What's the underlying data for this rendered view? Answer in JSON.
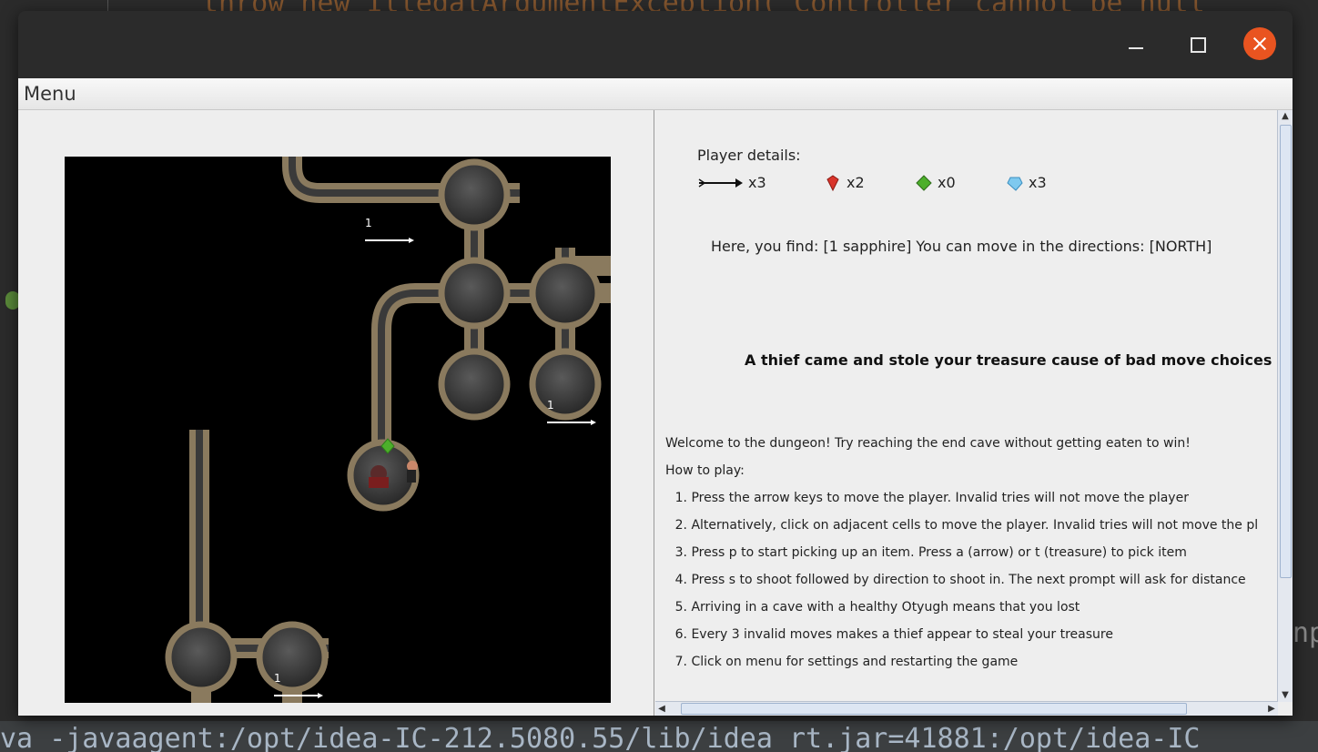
{
  "background": {
    "code_top": "throw new IllegalArgumentException(\"Controller cannot be null",
    "code_bottom": "va -javaagent:/opt/idea-IC-212.5080.55/lib/idea_rt.jar=41881:/opt/idea-IC",
    "right_fragment": "np"
  },
  "window": {
    "controls": {
      "minimize": "minimize-icon",
      "maximize": "maximize-icon",
      "close": "close-icon"
    }
  },
  "menubar": {
    "menu_label": "Menu"
  },
  "map": {
    "arrow_counts": [
      "1",
      "1",
      "1"
    ]
  },
  "player": {
    "title": "Player details:",
    "inventory": [
      {
        "icon": "arrow-icon",
        "label": "x3"
      },
      {
        "icon": "ruby-icon",
        "label": "x2"
      },
      {
        "icon": "emerald-icon",
        "label": "x0"
      },
      {
        "icon": "sapphire-icon",
        "label": "x3"
      }
    ]
  },
  "status": {
    "found": "Here, you find: [1 sapphire] You can move in the directions: [NORTH]",
    "thief": "A thief came and stole your treasure cause of bad move choices"
  },
  "help": {
    "welcome": "Welcome to the dungeon! Try reaching the end cave without getting eaten to win!",
    "how_to": "How to play:",
    "steps": [
      "Press the arrow keys to move the player. Invalid tries will not move the player",
      "Alternatively, click on adjacent cells to move the player. Invalid tries will not move the pl",
      "Press p to start picking up an item. Press a (arrow) or t (treasure) to pick item",
      "Press s to shoot followed by direction to shoot in. The next prompt will ask for distance",
      "Arriving in a cave with a healthy Otyugh means that you lost",
      "Every 3 invalid moves makes a thief appear to steal your treasure",
      "Click on menu for settings and restarting the game"
    ]
  },
  "colors": {
    "close_button": "#e95420",
    "tunnel": "#8a7a5e",
    "cave": "#3c3c3c"
  }
}
